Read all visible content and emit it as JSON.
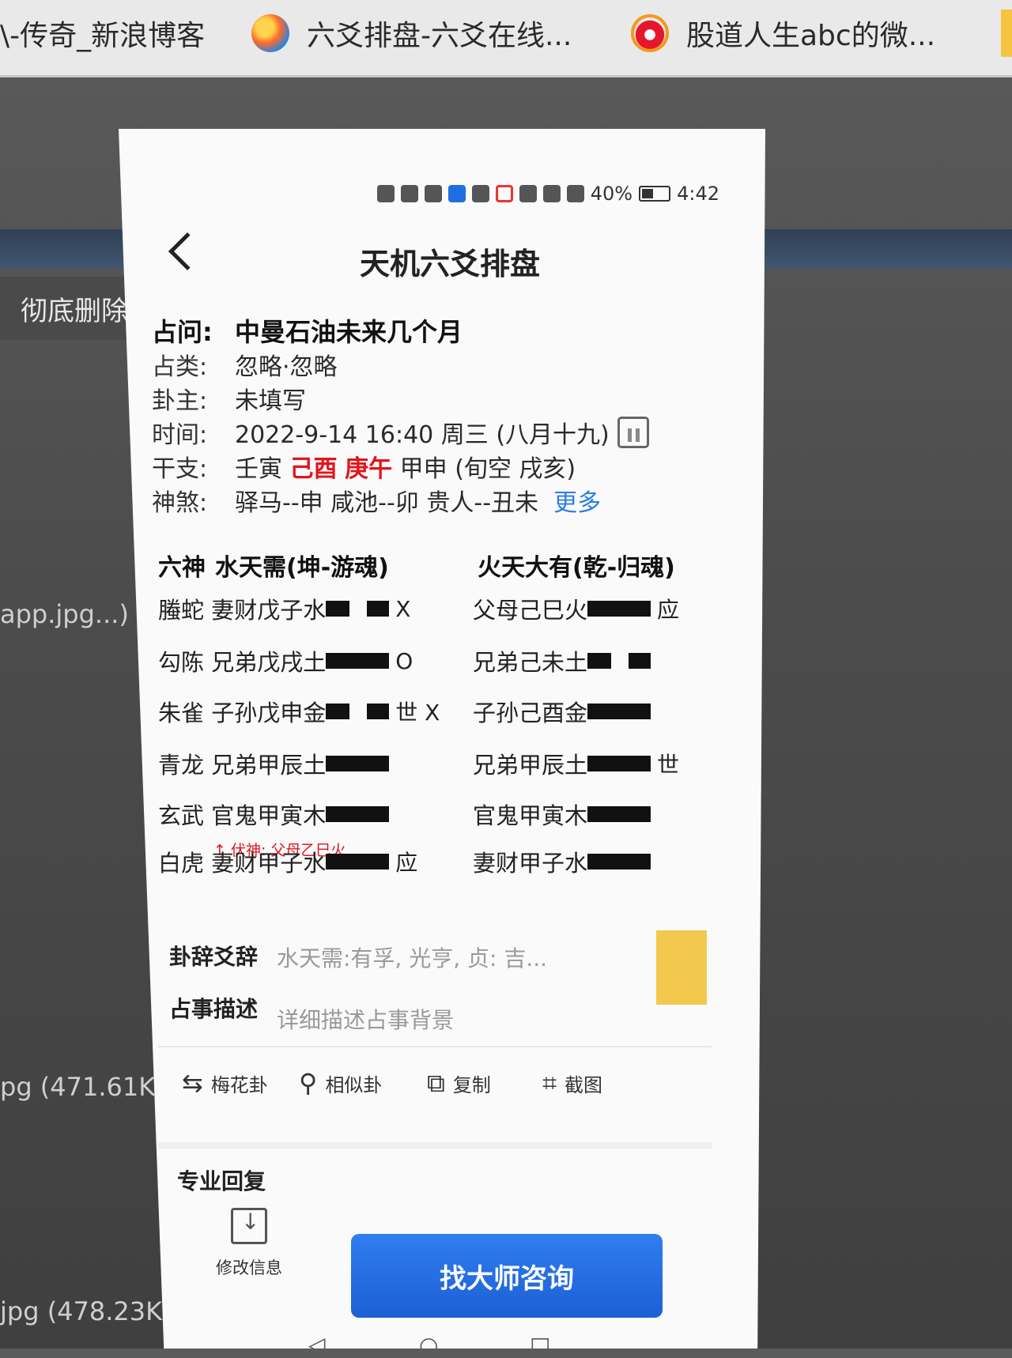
{
  "browser": {
    "tabs": [
      {
        "label": "\\-传奇_新浪博客",
        "icon": "blog-icon"
      },
      {
        "label": "六爻排盘-六爻在线...",
        "icon": "browser-logo-icon"
      },
      {
        "label": "股道人生abc的微...",
        "icon": "weibo-icon"
      }
    ],
    "bg_button": "彻底删除",
    "bg_files": [
      "app.jpg...)",
      "pg (471.61K",
      "jpg (478.23K"
    ]
  },
  "status_bar": {
    "battery": "40%",
    "time": "4:42"
  },
  "header": {
    "title": "天机六爻排盘"
  },
  "info": {
    "question_label": "占问:",
    "question": "中曼石油未来几个月",
    "category_label": "占类:",
    "category": "忽略·忽略",
    "owner_label": "卦主:",
    "owner": "未填写",
    "time_label": "时间:",
    "time": "2022-9-14 16:40 周三 (八月十九)",
    "ganzhi_label": "干支:",
    "ganzhi_1": "壬寅",
    "ganzhi_2": "己酉",
    "ganzhi_3": "庚午",
    "ganzhi_4": "甲申",
    "xunkong": "(旬空 戌亥)",
    "shensha_label": "神煞:",
    "shensha": "驿马--申  咸池--卯  贵人--丑未",
    "more": "更多"
  },
  "hexagram": {
    "liushen_label": "六神",
    "main_name": "水天需(坤-游魂)",
    "changed_name": "火天大有(乾-归魂)",
    "lines": [
      {
        "shen": "螣蛇",
        "main": "妻财戊子水",
        "main_type": "yin",
        "main_mark": "X",
        "changed": "父母己巳火",
        "changed_type": "yang",
        "changed_mark": "应"
      },
      {
        "shen": "勾陈",
        "main": "兄弟戊戌土",
        "main_type": "yang",
        "main_mark": "O",
        "changed": "兄弟己未土",
        "changed_type": "yin",
        "changed_mark": ""
      },
      {
        "shen": "朱雀",
        "main": "子孙戊申金",
        "main_type": "yin",
        "main_mark": "世 X",
        "changed": "子孙己酉金",
        "changed_type": "yang",
        "changed_mark": ""
      },
      {
        "shen": "青龙",
        "main": "兄弟甲辰土",
        "main_type": "yang",
        "main_mark": "",
        "changed": "兄弟甲辰土",
        "changed_type": "yang",
        "changed_mark": "世"
      },
      {
        "shen": "玄武",
        "main": "官鬼甲寅木",
        "main_type": "yang",
        "main_mark": "",
        "changed": "官鬼甲寅木",
        "changed_type": "yang",
        "changed_mark": ""
      },
      {
        "shen": "白虎",
        "main": "妻财甲子水",
        "main_type": "yang",
        "main_mark": "应",
        "changed": "妻财甲子水",
        "changed_type": "yang",
        "changed_mark": ""
      }
    ],
    "fushen": "↑ 伏神: 父母乙巳火"
  },
  "texts": {
    "guaci_label": "卦辞爻辞",
    "guaci": "水天需:有孚, 光亨, 贞: 吉...",
    "desc_label": "占事描述",
    "desc_placeholder": "详细描述占事背景"
  },
  "toolbar": [
    {
      "icon": "swap-icon",
      "label": "梅花卦"
    },
    {
      "icon": "search-icon",
      "label": "相似卦"
    },
    {
      "icon": "copy-icon",
      "label": "复制"
    },
    {
      "icon": "crop-icon",
      "label": "截图"
    }
  ],
  "footer": {
    "pro_label": "专业回复",
    "edit_label": "修改信息",
    "consult_label": "找大师咨询"
  }
}
